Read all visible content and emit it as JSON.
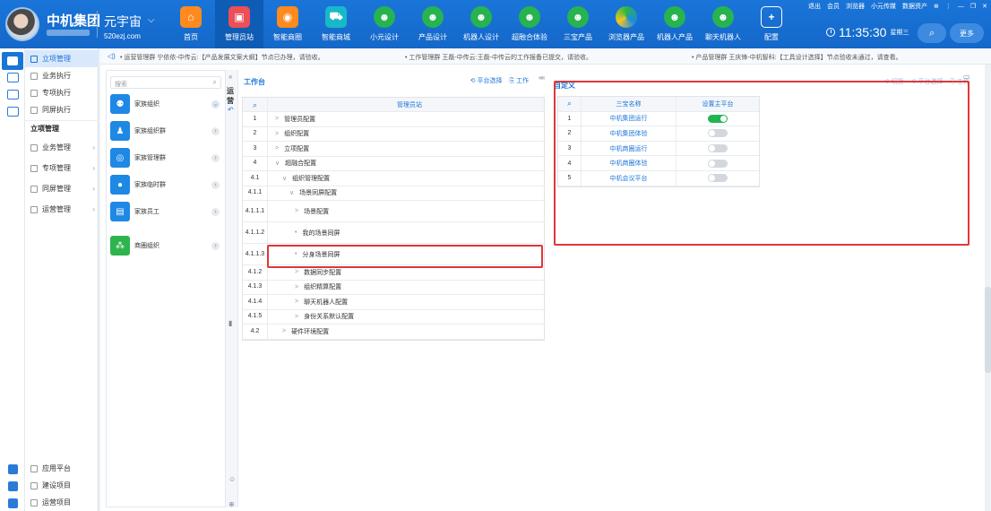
{
  "header": {
    "brand": "中机集团",
    "app_name": "元宇宙",
    "domain": "520ezj.com",
    "nav": [
      {
        "label": "首页",
        "icon": "home-icon",
        "color": "#ff8a1f"
      },
      {
        "label": "管理员站",
        "icon": "admin-station-icon",
        "color": "#ec4f57"
      },
      {
        "label": "智能商圈",
        "icon": "business-circle-icon",
        "color": "#ff8a1f"
      },
      {
        "label": "智能商城",
        "icon": "shopping-cart-icon",
        "color": "#19b8c9"
      },
      {
        "label": "小元设计",
        "icon": "robot-icon",
        "color": "#27b34f"
      },
      {
        "label": "产品设计",
        "icon": "robot-icon",
        "color": "#27b34f"
      },
      {
        "label": "机器人设计",
        "icon": "robot-icon",
        "color": "#27b34f"
      },
      {
        "label": "超融合体验",
        "icon": "robot-icon",
        "color": "#27b34f"
      },
      {
        "label": "三宝产品",
        "icon": "robot-icon",
        "color": "#27b34f"
      },
      {
        "label": "浏览器产品",
        "icon": "browser-icon",
        "color": "#1a8be0"
      },
      {
        "label": "机器人产品",
        "icon": "robot-icon",
        "color": "#27b34f"
      },
      {
        "label": "聊天机器人",
        "icon": "robot-icon",
        "color": "#27b34f"
      },
      {
        "label": "配置",
        "icon": "plus-icon",
        "color": "#ffffff"
      }
    ],
    "sys_links": [
      "退出",
      "会员",
      "浏览器",
      "小元传媒",
      "数据资产"
    ],
    "window_controls": [
      "⊕",
      "⋮",
      "—",
      "❐",
      "✕"
    ],
    "clock_time": "11:35:30",
    "clock_day": "星期三",
    "search_icon": "⌕",
    "more_label": "更多"
  },
  "sidebar": {
    "top_items": [
      {
        "label": "立项管理",
        "selected": true
      },
      {
        "label": "业务执行",
        "selected": false
      },
      {
        "label": "专项执行",
        "selected": false
      },
      {
        "label": "同屏执行",
        "selected": false
      }
    ],
    "section_title": "立项管理",
    "section_items": [
      "业务管理",
      "专项管理",
      "同屏管理",
      "运营管理"
    ],
    "bottom_items": [
      "应用平台",
      "建设项目",
      "运营项目"
    ]
  },
  "ticker": {
    "messages": [
      "• 运营管理群 宁依依-中传云:【产品发展文案大纲】节点已办理，请验收。",
      "• 工作管理群 王磊-中传云:王磊-中传云的工作报备已提交，请验收。",
      "• 产品管理群 王庆锋-中机智科:【工具设计选择】节点验收未通过，请查看。"
    ]
  },
  "contacts": {
    "search_placeholder": "搜索",
    "items": [
      {
        "name": "家族组织",
        "expanded": true
      },
      {
        "name": "家族组织群",
        "expanded": false
      },
      {
        "name": "家族管理群",
        "expanded": false
      },
      {
        "name": "家族临时群",
        "expanded": false
      },
      {
        "name": "家族员工",
        "expanded": false
      },
      {
        "name": "商圈组织",
        "expanded": false
      }
    ]
  },
  "strip_label": "运营",
  "workbench": {
    "title": "工作台",
    "tools": [
      "平台选择",
      "工作"
    ],
    "column_header": "管理员站",
    "rows": [
      {
        "num": "1",
        "label": "管理员配置",
        "marker": ">",
        "indent": 0
      },
      {
        "num": "2",
        "label": "组织配置",
        "marker": ">",
        "indent": 0
      },
      {
        "num": "3",
        "label": "立项配置",
        "marker": ">",
        "indent": 0
      },
      {
        "num": "4",
        "label": "超融合配置",
        "marker": "∨",
        "indent": 0
      },
      {
        "num": "4.1",
        "label": "组织管理配置",
        "marker": "∨",
        "indent": 1
      },
      {
        "num": "4.1.1",
        "label": "场景同屏配置",
        "marker": "∨",
        "indent": 2
      },
      {
        "num": "4.1.1.1",
        "label": "场景配置",
        "marker": ">",
        "indent": 3
      },
      {
        "num": "4.1.1.2",
        "label": "我的场景同屏",
        "marker": "•",
        "indent": 3
      },
      {
        "num": "4.1.1.3",
        "label": "分身场景同屏",
        "marker": "•",
        "indent": 3
      },
      {
        "num": "4.1.2",
        "label": "数据同步配置",
        "marker": ">",
        "indent": 2
      },
      {
        "num": "4.1.3",
        "label": "组织精算配置",
        "marker": ">",
        "indent": 2
      },
      {
        "num": "4.1.4",
        "label": "聊天机器人配置",
        "marker": ">",
        "indent": 2
      },
      {
        "num": "4.1.5",
        "label": "身份关系默认配置",
        "marker": ">",
        "indent": 2
      },
      {
        "num": "4.2",
        "label": "硬件环境配置",
        "marker": ">",
        "indent": 1
      }
    ]
  },
  "custom_panel": {
    "title": "自定义",
    "tools": [
      "切换",
      "平台选择",
      "工作"
    ],
    "headers": [
      "三宝名称",
      "设置主平台"
    ],
    "rows": [
      {
        "num": "1",
        "name": "中机集团运行",
        "main": true
      },
      {
        "num": "2",
        "name": "中机集团体验",
        "main": false
      },
      {
        "num": "3",
        "name": "中机商圈运行",
        "main": false
      },
      {
        "num": "4",
        "name": "中机商圈体验",
        "main": false
      },
      {
        "num": "5",
        "name": "中机会议平台",
        "main": false
      }
    ]
  },
  "colors": {
    "header_blue": "#1a75d9",
    "active_nav": "#0f5cb5",
    "highlight_red": "#e03737",
    "toggle_on": "#1fb553"
  }
}
